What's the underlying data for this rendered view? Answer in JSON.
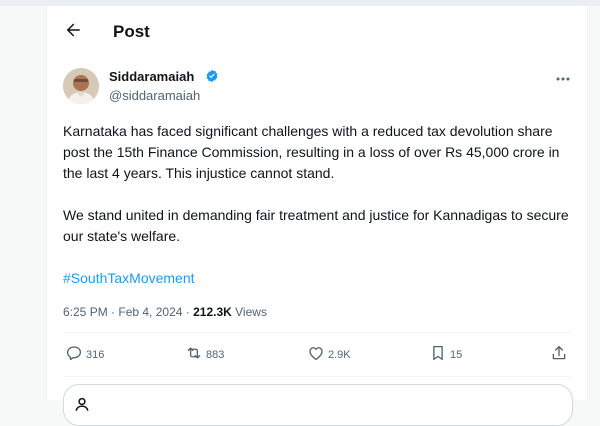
{
  "header": {
    "title": "Post",
    "back_icon": "arrow-left-icon"
  },
  "author": {
    "display_name": "Siddaramaiah",
    "handle": "@siddaramaiah",
    "verified_icon": "verified-badge-icon",
    "verified_color": "#1d9bf0"
  },
  "tweet": {
    "paragraph_1": "Karnataka has faced significant challenges with a reduced tax devolution share post the 15th Finance Commission, resulting in a loss of over Rs 45,000 crore in the last 4 years. This injustice cannot stand.",
    "paragraph_2": "We stand united in demanding fair treatment and justice for Kannadigas to secure our state's welfare.",
    "hashtag": "#SouthTaxMovement",
    "link_color": "#1d9bf0"
  },
  "meta": {
    "time": "6:25 PM",
    "separator": " · ",
    "date": "Feb 4, 2024",
    "views_count": "212.3K",
    "views_label": " Views"
  },
  "actions": {
    "replies": "316",
    "reposts": "883",
    "likes": "2.9K",
    "bookmarks": "15",
    "reply_icon": "reply-icon",
    "repost_icon": "repost-icon",
    "like_icon": "heart-icon",
    "bookmark_icon": "bookmark-icon",
    "share_icon": "share-icon"
  }
}
